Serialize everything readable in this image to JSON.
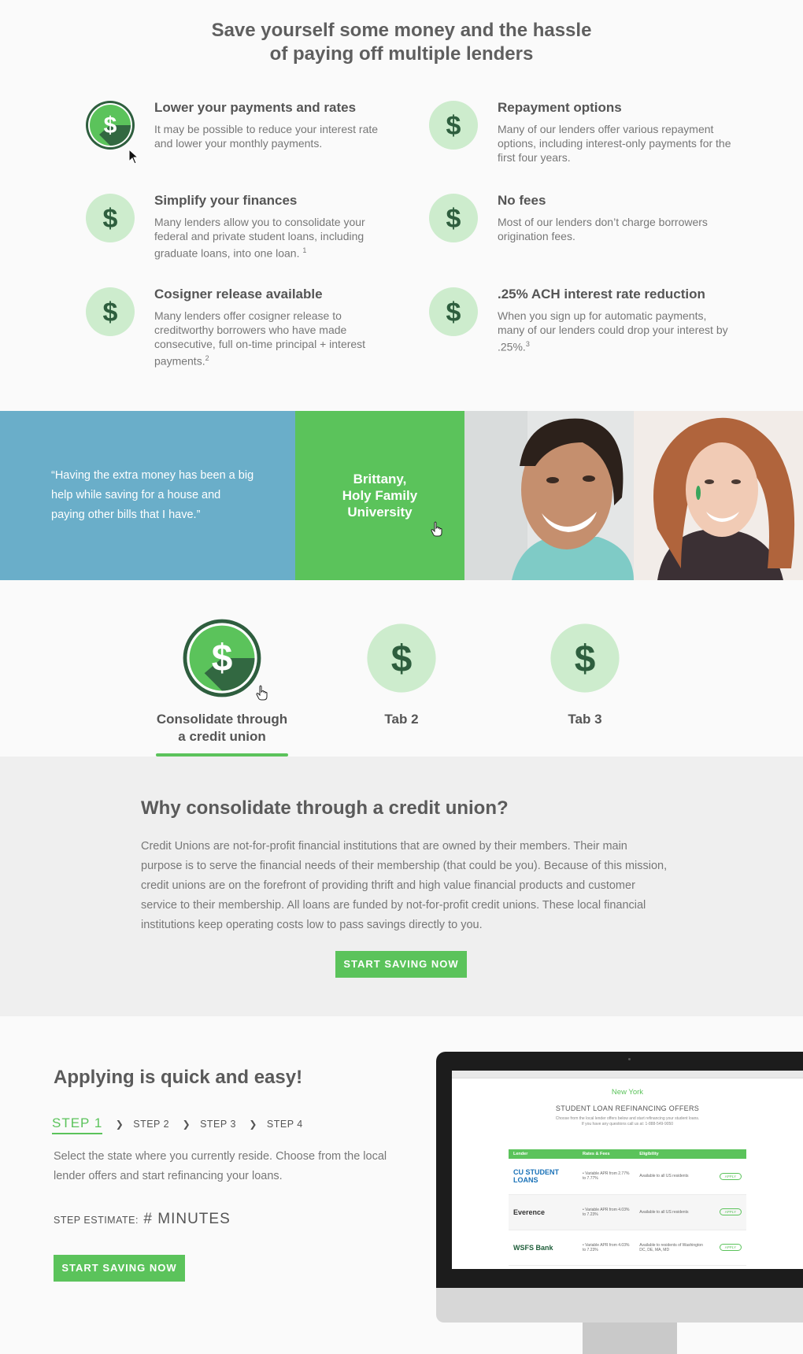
{
  "headline": {
    "line1": "Save yourself some money and the hassle",
    "line2": "of paying off multiple lenders"
  },
  "benefits": [
    {
      "title": "Lower your payments and rates",
      "body": "It may be possible to reduce your interest rate and lower your monthly payments.",
      "sup": "",
      "icon": "dollar-icon",
      "active": true
    },
    {
      "title": "Repayment options",
      "body": "Many of our lenders offer various repayment options, including interest-only payments for the first four years.",
      "sup": "",
      "icon": "dollar-icon",
      "active": false
    },
    {
      "title": "Simplify your finances",
      "body": "Many lenders allow you to consolidate your federal and private student loans, including graduate loans, into one loan.",
      "sup": "1",
      "icon": "dollar-icon",
      "active": false
    },
    {
      "title": "No fees",
      "body": "Most of our lenders don’t charge borrowers origination fees.",
      "sup": "",
      "icon": "dollar-icon",
      "active": false
    },
    {
      "title": "Cosigner release available",
      "body": "Many lenders offer cosigner release to creditworthy borrowers who have made consecutive, full on-time principal + interest payments.",
      "sup": "2",
      "icon": "dollar-icon",
      "active": false
    },
    {
      "title": ".25% ACH interest rate reduction",
      "body": "When you sign up for automatic payments, many of our lenders could drop your interest by .25%.",
      "sup": "3",
      "icon": "dollar-icon",
      "active": false
    }
  ],
  "testimonial": {
    "quote": "“Having the extra money has been a big help while saving for a house and paying other bills that I have.”",
    "name_line1": "Brittany,",
    "name_line2": "Holy Family",
    "name_line3": "University"
  },
  "tabs": [
    {
      "label_line1": "Consolidate through",
      "label_line2": "a credit union",
      "active": true
    },
    {
      "label_line1": "Tab 2",
      "label_line2": "",
      "active": false
    },
    {
      "label_line1": "Tab 3",
      "label_line2": "",
      "active": false
    }
  ],
  "why": {
    "title": "Why consolidate through a credit union?",
    "body": "Credit Unions are not-for-profit financial institutions that are owned by their members. Their main purpose is to serve the financial needs of their membership (that could be you). Because of this mission, credit unions are on the forefront of providing thrift and high value financial products and customer service to their membership. All loans are funded by not-for-profit credit unions. These local financial institutions keep operating costs low to pass savings directly to you.",
    "cta": "Start saving now"
  },
  "apply": {
    "title": "Applying is quick and easy!",
    "step1": "STEP 1",
    "step2": "STEP 2",
    "step3": "STEP 3",
    "step4": "STEP 4",
    "desc": "Select the state where you currently reside. Choose from the local lender offers and start refinancing your loans.",
    "estimate_label": "STEP ESTIMATE:",
    "estimate_value": "# MINUTES",
    "cta": "Start saving now"
  },
  "screen": {
    "state": "New York",
    "title": "STUDENT LOAN REFINANCING OFFERS",
    "sub1": "Choose from the local lender offers below and start refinancing your student loans.",
    "sub2": "If you have any questions call us at: 1-888-549-9050",
    "headers": [
      "Lender",
      "Rates & Fees",
      "Eligibility",
      ""
    ],
    "rows": [
      {
        "lender": "CU STUDENT LOANS",
        "rates": "• Variable APR from 2.77% to 7.77%",
        "elig": "Available to all US residents",
        "cta": "APPLY"
      },
      {
        "lender": "Everence",
        "rates": "• Variable APR from 4.03% to 7.23%",
        "elig": "Available to all US residents",
        "cta": "APPLY"
      },
      {
        "lender": "WSFS Bank",
        "rates": "• Variable APR from 4.03% to 7.23%",
        "elig": "Available to residents of Washington DC, DE, MA, MD",
        "cta": "APPLY"
      }
    ]
  },
  "colors": {
    "green": "#5bc35b",
    "green_light": "#cdeccd",
    "green_dark": "#2e5e3e",
    "blue": "#6aaec9",
    "gray_bg": "#efefef"
  }
}
